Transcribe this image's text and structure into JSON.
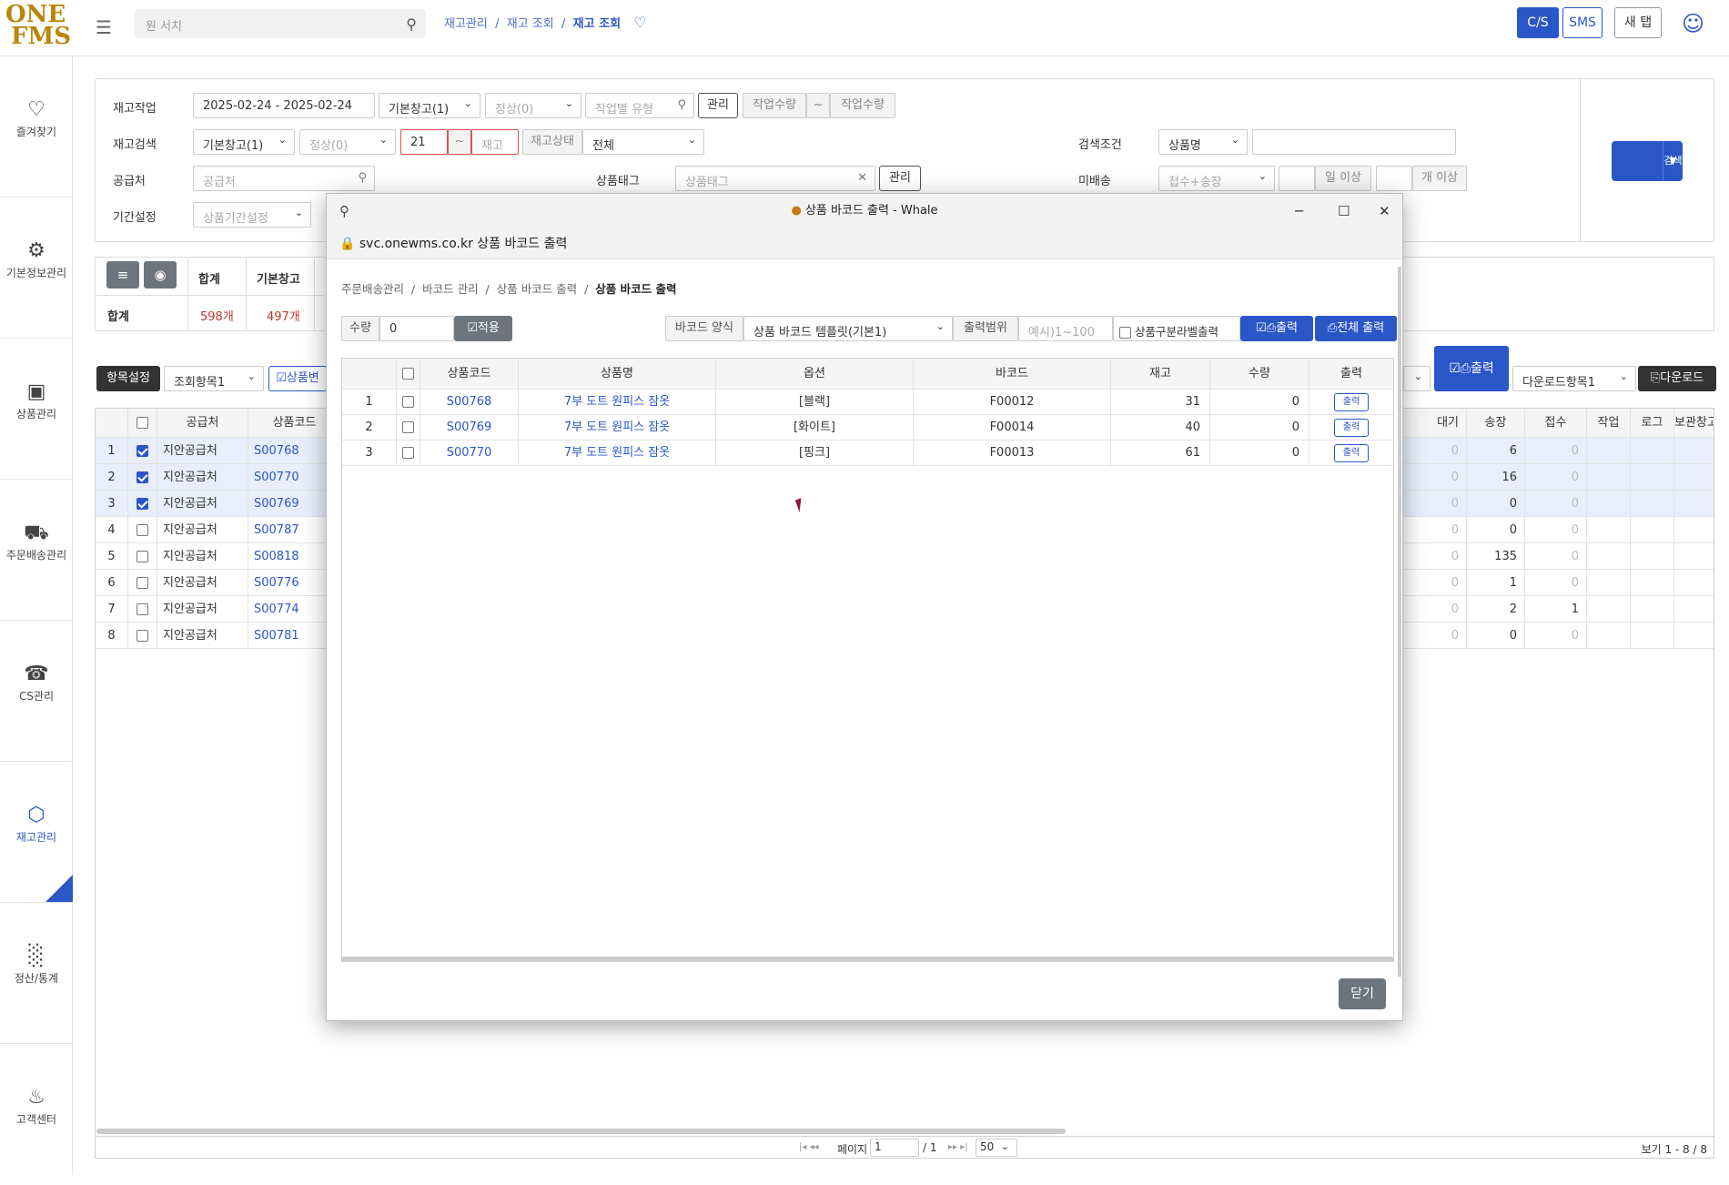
{
  "logo": {
    "line1": "ONE",
    "line2": "FMS"
  },
  "header": {
    "search_placeholder": "원 서치",
    "breadcrumb": [
      "재고관리",
      "재고 조회",
      "재고 조회"
    ],
    "buttons": {
      "cs": "C/S",
      "sms": "SMS",
      "newtab": "새 탭"
    }
  },
  "sidebar": {
    "items": [
      {
        "label": "즐겨찾기",
        "icon": "heart-icon"
      },
      {
        "label": "기본정보관리",
        "icon": "gear-icon"
      },
      {
        "label": "상품관리",
        "icon": "lock-icon"
      },
      {
        "label": "주문배송관리",
        "icon": "truck-icon"
      },
      {
        "label": "CS관리",
        "icon": "headset-icon"
      },
      {
        "label": "재고관리",
        "icon": "box-icon"
      },
      {
        "label": "정산/통계",
        "icon": "chart-icon"
      },
      {
        "label": "고객센터",
        "icon": "bell-icon"
      }
    ]
  },
  "filters": {
    "work_label": "재고작업",
    "date_range": "2025-02-24 - 2025-02-24",
    "warehouse": "기본창고(1)",
    "status": "정상(0)",
    "work_type_placeholder": "작업별 유형",
    "manage": "관리",
    "qty_from_placeholder": "작업수량",
    "tilde": "~",
    "qty_to_placeholder": "작업수량",
    "search_label": "재고검색",
    "warehouse2": "기본창고(1)",
    "status2": "정상(0)",
    "stock_from": "21",
    "stock_to_placeholder": "재고",
    "stock_status_label": "재고상태",
    "stock_status": "전체",
    "condition_label": "검색조건",
    "condition": "상품명",
    "supplier_label": "공급처",
    "supplier_placeholder": "공급처",
    "tag_label": "상품태그",
    "tag_placeholder": "상품태그",
    "tag_manage": "관리",
    "unshipped_label": "미배송",
    "unshipped": "접수+송장",
    "days_suffix": "일 이상",
    "count_suffix": "개 이상",
    "period_label": "기간설정",
    "period_placeholder": "상품기간설정",
    "search_button": "검색"
  },
  "summary": {
    "headers": [
      "합계",
      "기본창고"
    ],
    "row_label": "합계",
    "total": "598개",
    "basic": "497개"
  },
  "toolbar": {
    "settings": "항목설정",
    "view_items": "조회항목1",
    "product_change": "상품변",
    "print": "출력",
    "download_items": "다운로드항목1",
    "download": "다운로드"
  },
  "main_table": {
    "headers": [
      "공급처",
      "상품코드"
    ],
    "right_headers": [
      "대기",
      "송장",
      "접수",
      "작업",
      "로그",
      "보관창고"
    ],
    "rows": [
      {
        "n": "1",
        "checked": true,
        "supplier": "지안공급처",
        "code": "S00768",
        "wait": "0",
        "invoice": "6",
        "recv": "0"
      },
      {
        "n": "2",
        "checked": true,
        "supplier": "지안공급처",
        "code": "S00770",
        "wait": "0",
        "invoice": "16",
        "recv": "0"
      },
      {
        "n": "3",
        "checked": true,
        "supplier": "지안공급처",
        "code": "S00769",
        "wait": "0",
        "invoice": "0",
        "recv": "0"
      },
      {
        "n": "4",
        "checked": false,
        "supplier": "지안공급처",
        "code": "S00787",
        "wait": "0",
        "invoice": "0",
        "recv": "0"
      },
      {
        "n": "5",
        "checked": false,
        "supplier": "지안공급처",
        "code": "S00818",
        "wait": "0",
        "invoice": "135",
        "recv": "0"
      },
      {
        "n": "6",
        "checked": false,
        "supplier": "지안공급처",
        "code": "S00776",
        "wait": "0",
        "invoice": "1",
        "recv": "0"
      },
      {
        "n": "7",
        "checked": false,
        "supplier": "지안공급처",
        "code": "S00774",
        "wait": "0",
        "invoice": "2",
        "recv": "1"
      },
      {
        "n": "8",
        "checked": false,
        "supplier": "지안공급처",
        "code": "S00781",
        "wait": "0",
        "invoice": "0",
        "recv": "0"
      }
    ]
  },
  "pager": {
    "page_label": "페이지",
    "page": "1",
    "of": "/ 1",
    "size": "50",
    "view": "보기 1 - 8 / 8"
  },
  "modal": {
    "title": "상품 바코드 출력 - Whale",
    "url": "svc.onewms.co.kr",
    "url_title": "상품 바코드 출력",
    "breadcrumb": [
      "주문배송관리",
      "바코드 관리",
      "상품 바코드 출력",
      "상품 바코드 출력"
    ],
    "qty_label": "수량",
    "qty_value": "0",
    "apply": "적용",
    "format_label": "바코드 양식",
    "format_value": "상품 바코드 템플릿(기본1)",
    "range_label": "출력범위",
    "range_placeholder": "예시)1~100",
    "split_label": "상품구분라벨출력",
    "print": "출력",
    "print_all": "전체 출력",
    "headers": [
      "상품코드",
      "상품명",
      "옵션",
      "바코드",
      "재고",
      "수량",
      "출력"
    ],
    "rows": [
      {
        "n": "1",
        "code": "S00768",
        "name": "7부 도트 원피스 잠옷",
        "option": "[블랙]",
        "barcode": "F00012",
        "stock": "31",
        "qty": "0",
        "btn": "출력"
      },
      {
        "n": "2",
        "code": "S00769",
        "name": "7부 도트 원피스 잠옷",
        "option": "[화이트]",
        "barcode": "F00014",
        "stock": "40",
        "qty": "0",
        "btn": "출력"
      },
      {
        "n": "3",
        "code": "S00770",
        "name": "7부 도트 원피스 잠옷",
        "option": "[핑크]",
        "barcode": "F00013",
        "stock": "61",
        "qty": "0",
        "btn": "출력"
      }
    ],
    "close": "닫기"
  }
}
